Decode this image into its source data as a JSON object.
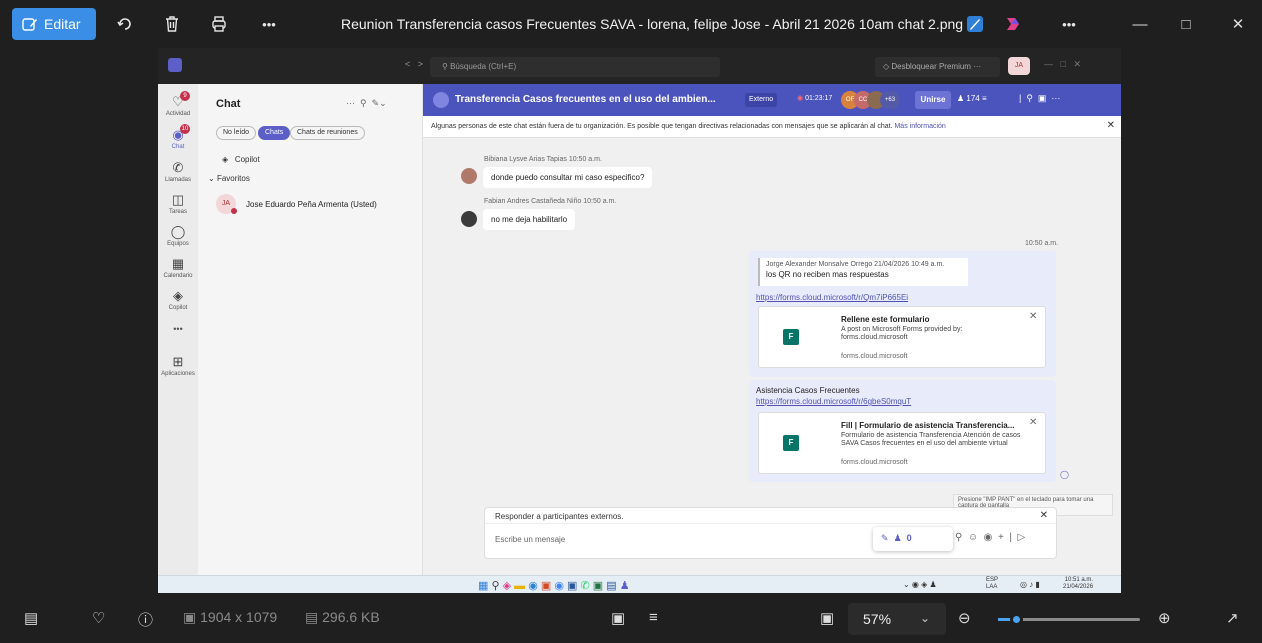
{
  "viewer": {
    "edit_label": "Editar",
    "file_title": "Reunion Transferencia casos Frecuentes  SAVA - lorena, felipe Jose - Abril 21 2026 10am  chat 2.png",
    "more": "•••",
    "dimensions": "1904 x 1079",
    "filesize": "296.6 KB",
    "zoom": "57%"
  },
  "teams": {
    "search_placeholder": "Búsqueda (Ctrl+E)",
    "premium": "Desbloquear Premium",
    "me_initials": "JA",
    "rail": {
      "actividad": "Actividad",
      "actividad_badge": "9",
      "chat": "Chat",
      "chat_badge": "10",
      "llamadas": "Llamadas",
      "tareas": "Tareas",
      "equipos": "Equipos",
      "calendario": "Calendario",
      "copilot": "Copilot",
      "more": "•••",
      "aplicaciones": "Aplicaciones"
    },
    "chatlist": {
      "title": "Chat",
      "filters": [
        "No leído",
        "Chats",
        "Chats de reuniones"
      ],
      "copilot": "Copilot",
      "favoritos": "Favoritos",
      "contact_initials": "JA",
      "contact_name": "Jose Eduardo Peña Armenta (Usted)"
    },
    "conversation": {
      "title": "Transferencia Casos frecuentes en el uso del ambien...",
      "externo": "Externo",
      "timer": "01:23:17",
      "avatars": [
        "OF",
        "CC",
        "",
        "+63"
      ],
      "join": "Unirse",
      "participants": "174",
      "notice": "Algunas personas de este chat están fuera de tu organización. Es posible que tengan directivas relacionadas con mensajes que se aplicarán al chat.",
      "notice_link": "Más información"
    },
    "messages": {
      "m1_name": "Bibiana Lysve Arias Tapias  10:50 a.m.",
      "m1_text": "donde puedo consultar mi caso especifico?",
      "m2_name": "Fabian Andres Castañeda Niño  10:50 a.m.",
      "m2_text": "no me deja habilitarlo",
      "mine_time": "10:50 a.m.",
      "quote_author": "Jorge Alexander Monsalve Orrego  21/04/2026 10:49 a.m.",
      "quote_text": "los QR no reciben mas respuestas",
      "link1": "https://forms.cloud.microsoft/r/Qm7iP665Ei",
      "card1_title": "Rellene este formulario",
      "card1_desc1": "A post on Microsoft Forms provided by:",
      "card1_desc2": "forms.cloud.microsoft",
      "card1_domain": "forms.cloud.microsoft",
      "m4_text": "Asistencia Casos Frecuentes",
      "link2": "https://forms.cloud.microsoft/r/6gbeS0mquT",
      "card2_title": "Fill | Formulario de asistencia Transferencia...",
      "card2_desc1": "Formulario de asistencia Transferencia Atención de casos",
      "card2_desc2": "SAVA Casos frecuentes en el uso del ambiente virtual",
      "card2_domain": "forms.cloud.microsoft"
    },
    "compose": {
      "reply_external": "Responder a participantes externos.",
      "placeholder": "Escribe un mensaje",
      "tooltip1": "Presione \"IMP PANT\" en el teclado para tomar una",
      "tooltip2": "captura de pantalla",
      "count": "0"
    },
    "taskbar": {
      "lang1": "ESP",
      "lang2": "LAA",
      "time": "10:51 a.m.",
      "date": "21/04/2026"
    }
  }
}
